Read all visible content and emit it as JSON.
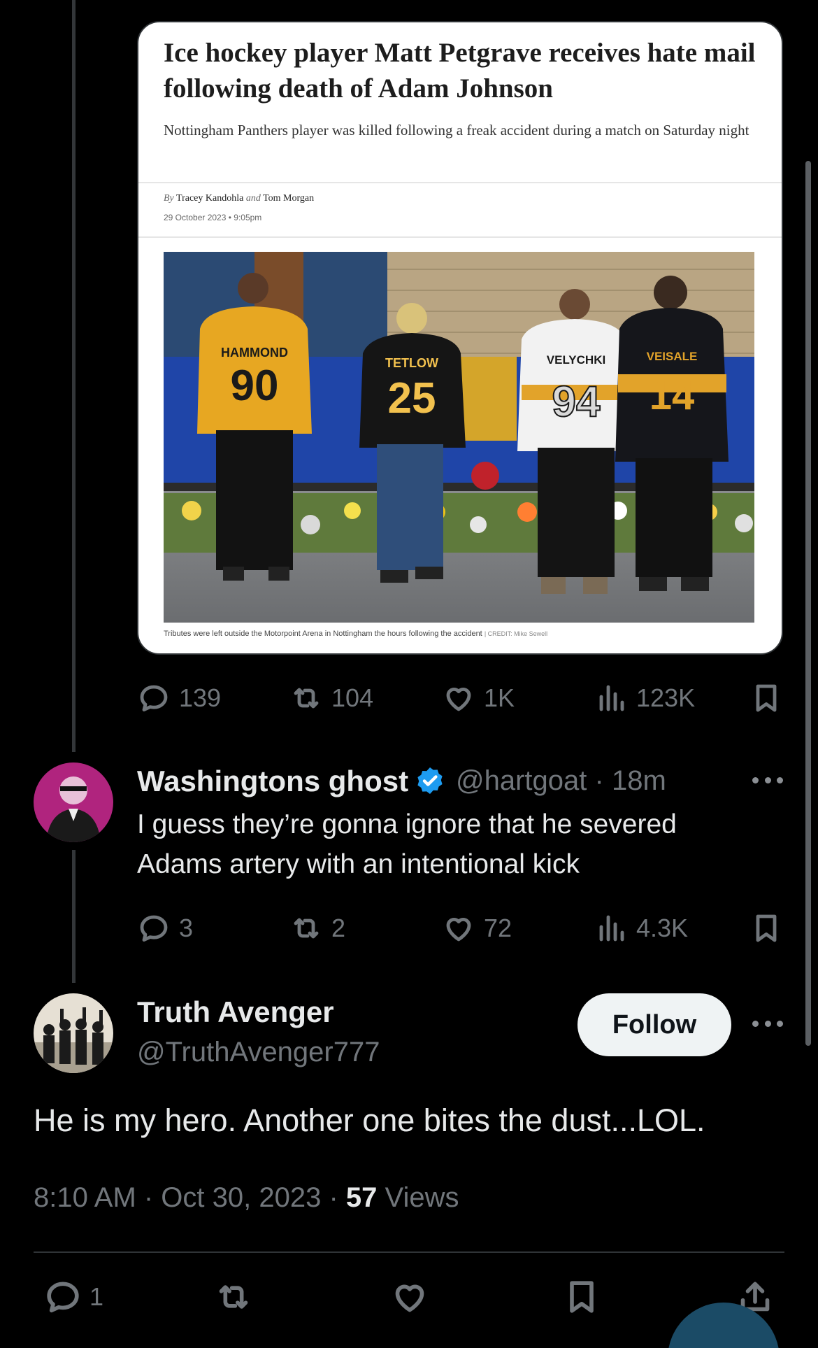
{
  "quoted_article": {
    "headline": "Ice hockey player Matt Petgrave receives hate mail following death of Adam Johnson",
    "standfirst": "Nottingham Panthers player was killed following a freak accident during a match on Saturday night",
    "byline_prefix": "By",
    "author_1": "Tracey Kandohla",
    "byline_and": "and",
    "author_2": "Tom Morgan",
    "date": "29 October 2023 • 9:05pm",
    "jerseys": [
      {
        "name": "HAMMOND",
        "number": "90"
      },
      {
        "name": "TETLOW",
        "number": "25"
      },
      {
        "name": "VELYCHKI",
        "number": "94"
      },
      {
        "name": "VEISALE",
        "number": "14"
      }
    ],
    "caption": "Tributes were left outside the Motorpoint Arena in Nottingham the hours following the accident",
    "credit": "| CREDIT: Mike Sewell"
  },
  "original_actions": {
    "replies": "139",
    "reposts": "104",
    "likes": "1K",
    "views": "123K"
  },
  "reply": {
    "name": "Washingtons ghost",
    "handle": "@hartgoat",
    "time": "· 18m",
    "text": "I guess they’re gonna ignore that he severed Adams artery with an intentional kick",
    "replies": "3",
    "reposts": "2",
    "likes": "72",
    "views": "4.3K"
  },
  "focused_tweet": {
    "name": "Truth Avenger",
    "handle": "@TruthAvenger777",
    "follow_label": "Follow",
    "text": "He is my hero. Another one bites the dust...LOL.",
    "time_date": "8:10 AM · Oct 30, 2023 · ",
    "views_count": "57",
    "views_label": " Views",
    "replies": "1"
  },
  "icons": {
    "reply": "reply-icon",
    "repost": "repost-icon",
    "like": "heart-icon",
    "views": "views-icon",
    "bookmark": "bookmark-icon",
    "share": "share-icon",
    "verified": "verified-badge-icon",
    "more": "more-icon"
  },
  "colors": {
    "background": "#000000",
    "text_primary": "#e7e9ea",
    "text_secondary": "#71767b",
    "verified_blue": "#1d9bf0",
    "follow_button_bg": "#eff3f4"
  }
}
